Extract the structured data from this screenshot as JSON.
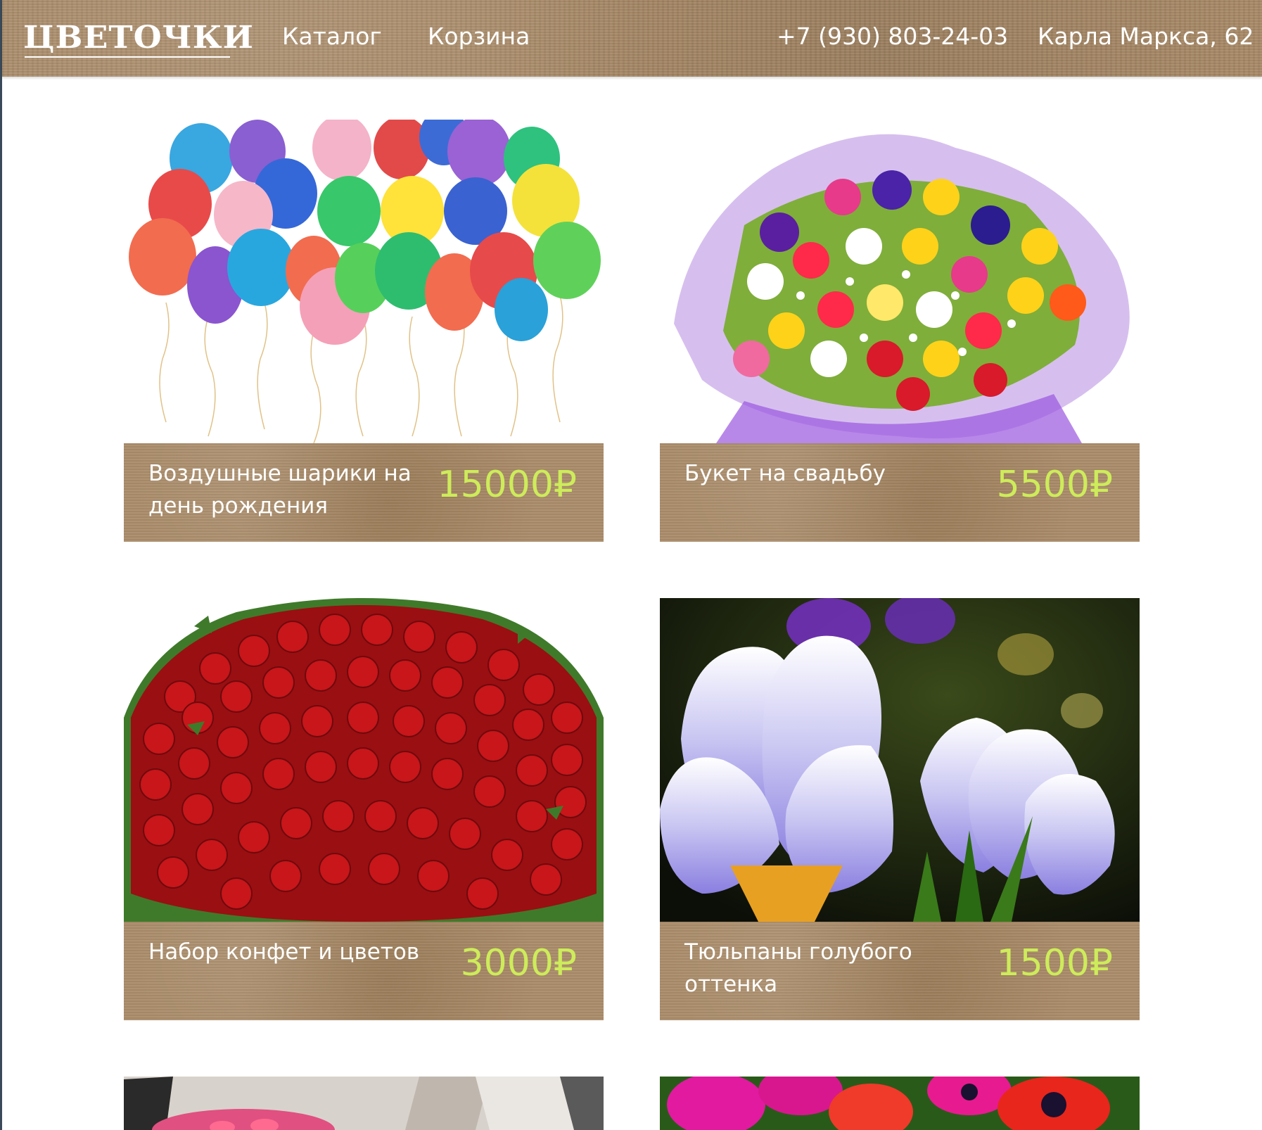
{
  "header": {
    "logo": "ЦВЕТОЧКИ",
    "nav": {
      "catalog": "Каталог",
      "cart": "Корзина"
    },
    "phone": "+7 (930) 803-24-03",
    "address": "Карла Маркса, 62"
  },
  "products": [
    {
      "title": "Воздушные шарики на день рождения",
      "price": "15000₽",
      "image": "balloons"
    },
    {
      "title": "Букет на свадьбу",
      "price": "5500₽",
      "image": "tulip-bouquet"
    },
    {
      "title": "Набор конфет и цветов",
      "price": "3000₽",
      "image": "red-roses"
    },
    {
      "title": "Тюльпаны голубого оттенка",
      "price": "1500₽",
      "image": "blue-crocuses"
    },
    {
      "image": "pink-roses-in-car"
    },
    {
      "image": "magenta-anemones"
    }
  ],
  "colors": {
    "header_bg": "#a88966",
    "price": "#ccec55",
    "text": "#ffffff"
  }
}
